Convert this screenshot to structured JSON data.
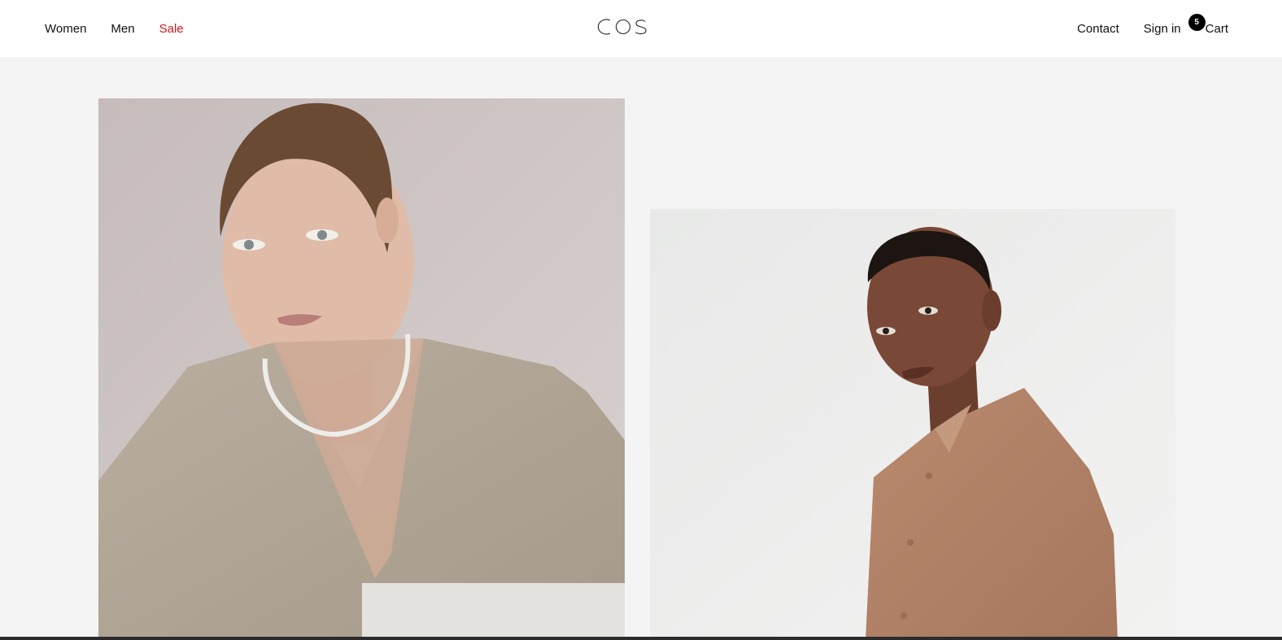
{
  "nav": {
    "women": "Women",
    "men": "Men",
    "sale": "Sale",
    "contact": "Contact",
    "sign_in": "Sign in",
    "cart_label": "Cart",
    "cart_count": "5"
  },
  "brand": {
    "logo_text": "COS",
    "sale_color": "#d8141c"
  },
  "hero": {
    "images": [
      {
        "name": "woman-portrait"
      },
      {
        "name": "man-portrait"
      }
    ]
  }
}
